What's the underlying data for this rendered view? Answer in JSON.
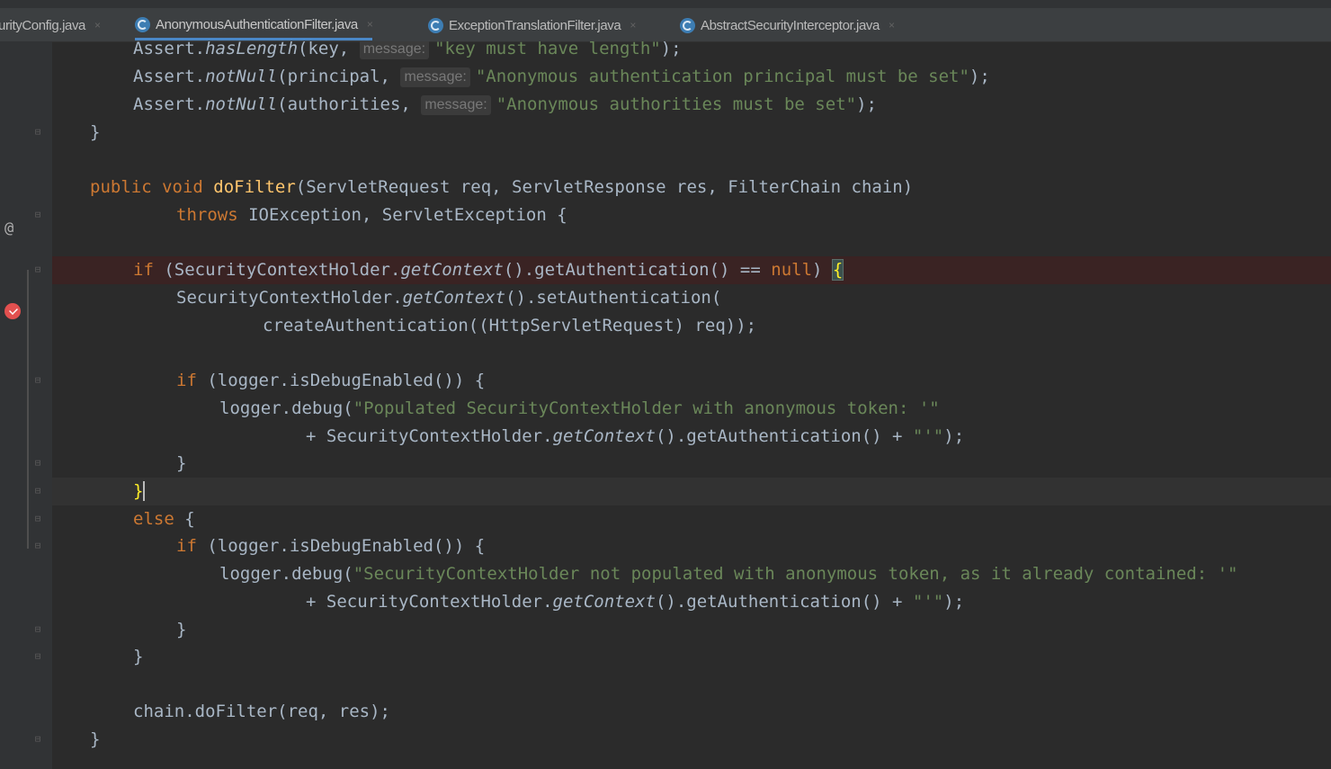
{
  "tabs": [
    {
      "label": "urityConfig.java"
    },
    {
      "label": "AnonymousAuthenticationFilter.java"
    },
    {
      "label": "ExceptionTranslationFilter.java"
    },
    {
      "label": "AbstractSecurityInterceptor.java"
    }
  ],
  "tab_close_glyph": "×",
  "gutter": {
    "override_icon": "at-sign-icon",
    "override_glyph": "@",
    "breakpoint_icon": "breakpoint-icon"
  },
  "code": {
    "l1": {
      "a": "Assert.",
      "b": "hasLength",
      "c": "(key,",
      "hint": "message:",
      "d": "\"key must have length\"",
      "e": ");"
    },
    "l2": {
      "a": "Assert.",
      "b": "notNull",
      "c": "(principal,",
      "hint": "message:",
      "d": "\"Anonymous authentication principal must be set\"",
      "e": ");"
    },
    "l3": {
      "a": "Assert.",
      "b": "notNull",
      "c": "(authorities,",
      "hint": "message:",
      "d": "\"Anonymous authorities must be set\"",
      "e": ");"
    },
    "l4": {
      "a": "}"
    },
    "l6": {
      "a": "public void ",
      "b": "doFilter",
      "c": "(ServletRequest req, ServletResponse res, FilterChain chain)"
    },
    "l7": {
      "a": "throws ",
      "b": "IOException, ServletException {"
    },
    "l9": {
      "a": "if ",
      "b": "(SecurityContextHolder.",
      "c": "getContext",
      "d": "().getAuthentication() == ",
      "e": "null",
      "f": ") ",
      "g": "{"
    },
    "l10": {
      "a": "SecurityContextHolder.",
      "b": "getContext",
      "c": "().setAuthentication("
    },
    "l11": {
      "a": "createAuthentication((HttpServletRequest) req));"
    },
    "l13": {
      "a": "if ",
      "b": "(logger.isDebugEnabled()) {"
    },
    "l14": {
      "a": "logger.debug(",
      "b": "\"Populated SecurityContextHolder with anonymous token: '\""
    },
    "l15": {
      "a": "+ SecurityContextHolder.",
      "b": "getContext",
      "c": "().getAuthentication() + ",
      "d": "\"'\"",
      "e": ");"
    },
    "l16": {
      "a": "}"
    },
    "l17": {
      "a": "}"
    },
    "l18": {
      "a": "else ",
      "b": "{"
    },
    "l19": {
      "a": "if ",
      "b": "(logger.isDebugEnabled()) {"
    },
    "l20": {
      "a": "logger.debug(",
      "b": "\"SecurityContextHolder not populated with anonymous token, as it already contained: '\""
    },
    "l21": {
      "a": "+ SecurityContextHolder.",
      "b": "getContext",
      "c": "().getAuthentication() + ",
      "d": "\"'\"",
      "e": ");"
    },
    "l22": {
      "a": "}"
    },
    "l23": {
      "a": "}"
    },
    "l25": {
      "a": "chain.doFilter(req, res);"
    },
    "l26": {
      "a": "}"
    }
  },
  "colors": {
    "keyword": "#cc7832",
    "function": "#ffc66d",
    "string": "#6a8759",
    "text": "#a9b7c6",
    "breakpoint_line": "#3a2323",
    "accent": "#4a88c7"
  }
}
